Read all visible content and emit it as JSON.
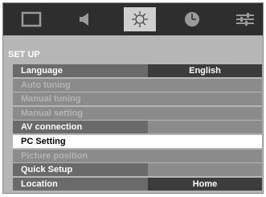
{
  "tabs": [
    {
      "name": "picture",
      "icon": "screen-icon",
      "active": false
    },
    {
      "name": "sound",
      "icon": "speaker-icon",
      "active": false
    },
    {
      "name": "setup",
      "icon": "gear-icon",
      "active": true
    },
    {
      "name": "timer",
      "icon": "clock-icon",
      "active": false
    },
    {
      "name": "features",
      "icon": "sliders-icon",
      "active": false
    }
  ],
  "section_title": "SET UP",
  "menu": [
    {
      "label": "Language",
      "value": "English",
      "state": "withvalue"
    },
    {
      "label": "Auto tuning",
      "value": "",
      "state": "disabled"
    },
    {
      "label": "Manual tuning",
      "value": "",
      "state": "disabled"
    },
    {
      "label": "Manual setting",
      "value": "",
      "state": "disabled"
    },
    {
      "label": "AV connection",
      "value": "",
      "state": "enabled"
    },
    {
      "label": "PC Setting",
      "value": "",
      "state": "selected"
    },
    {
      "label": "Picture position",
      "value": "",
      "state": "disabled"
    },
    {
      "label": "Quick Setup",
      "value": "",
      "state": "enabled"
    },
    {
      "label": "Location",
      "value": "Home",
      "state": "withvalue"
    }
  ]
}
